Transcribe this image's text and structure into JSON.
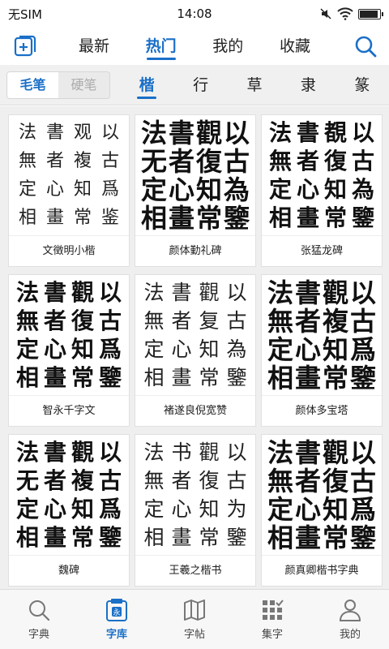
{
  "status": {
    "carrier": "无SIM",
    "time": "14:08",
    "battery_level": 0.85
  },
  "topnav": {
    "tabs": [
      "最新",
      "热门",
      "我的",
      "收藏"
    ],
    "active": 1
  },
  "subnav": {
    "brush": "毛笔",
    "pen": "硬笔",
    "styles": [
      "楷",
      "行",
      "草",
      "隶",
      "篆"
    ],
    "active_style": 0
  },
  "sample_text": [
    "法",
    "書",
    "觀",
    "以",
    "無",
    "者",
    "複",
    "古",
    "定",
    "心",
    "知",
    "爲",
    "相",
    "畫",
    "常",
    "鑒"
  ],
  "cards": [
    {
      "name": "文徵明小楷",
      "chars": [
        "法",
        "書",
        "观",
        "以",
        "無",
        "者",
        "複",
        "古",
        "定",
        "心",
        "知",
        "爲",
        "相",
        "畫",
        "常",
        "鉴"
      ]
    },
    {
      "name": "颜体勤礼碑",
      "chars": [
        "法",
        "書",
        "觀",
        "以",
        "无",
        "者",
        "復",
        "古",
        "定",
        "心",
        "知",
        "為",
        "相",
        "畫",
        "常",
        "鑒"
      ]
    },
    {
      "name": "张猛龙碑",
      "chars": [
        "法",
        "書",
        "覩",
        "以",
        "無",
        "者",
        "復",
        "古",
        "定",
        "心",
        "知",
        "為",
        "相",
        "畫",
        "常",
        "鑒"
      ]
    },
    {
      "name": "智永千字文",
      "chars": [
        "法",
        "書",
        "觀",
        "以",
        "無",
        "者",
        "復",
        "古",
        "定",
        "心",
        "知",
        "爲",
        "相",
        "畫",
        "常",
        "鑒"
      ]
    },
    {
      "name": "褚遂良倪宽赞",
      "chars": [
        "法",
        "書",
        "觀",
        "以",
        "無",
        "者",
        "复",
        "古",
        "定",
        "心",
        "知",
        "為",
        "相",
        "畫",
        "常",
        "鑒"
      ]
    },
    {
      "name": "颜体多宝塔",
      "chars": [
        "法",
        "書",
        "觀",
        "以",
        "無",
        "者",
        "複",
        "古",
        "定",
        "心",
        "知",
        "爲",
        "相",
        "畫",
        "常",
        "鑒"
      ]
    },
    {
      "name": "魏碑",
      "chars": [
        "法",
        "書",
        "觀",
        "以",
        "无",
        "者",
        "複",
        "古",
        "定",
        "心",
        "知",
        "爲",
        "相",
        "畫",
        "常",
        "鑒"
      ]
    },
    {
      "name": "王羲之楷书",
      "chars": [
        "法",
        "书",
        "觀",
        "以",
        "無",
        "者",
        "復",
        "古",
        "定",
        "心",
        "知",
        "为",
        "相",
        "畫",
        "常",
        "鑒"
      ]
    },
    {
      "name": "颜真卿楷书字典",
      "chars": [
        "法",
        "書",
        "觀",
        "以",
        "無",
        "者",
        "復",
        "古",
        "定",
        "心",
        "知",
        "爲",
        "相",
        "畫",
        "常",
        "鑒"
      ]
    }
  ],
  "bottom_nav": [
    {
      "label": "字典",
      "icon": "search-icon"
    },
    {
      "label": "字库",
      "icon": "stamp-icon"
    },
    {
      "label": "字帖",
      "icon": "map-icon"
    },
    {
      "label": "集字",
      "icon": "grid-icon"
    },
    {
      "label": "我的",
      "icon": "person-icon"
    }
  ],
  "bottom_active": 1,
  "colors": {
    "accent": "#1a6fc7"
  }
}
